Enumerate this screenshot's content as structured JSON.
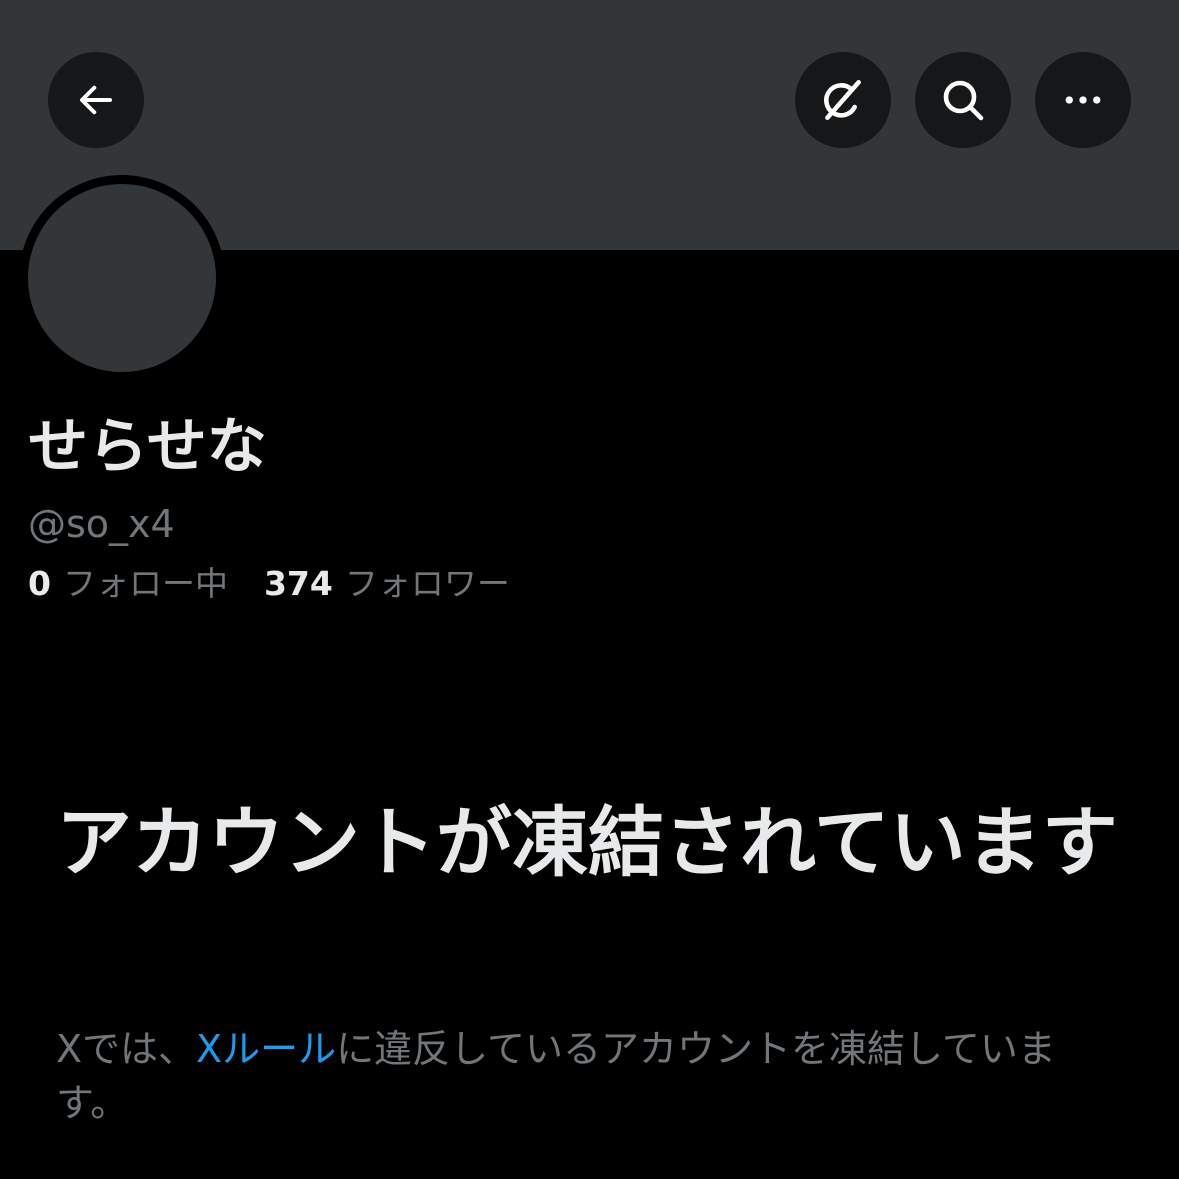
{
  "header": {
    "back_icon": "arrow-left-icon",
    "grok_icon": "grok-icon",
    "search_icon": "search-icon",
    "more_icon": "more-horizontal-icon"
  },
  "profile": {
    "display_name": "せらせな",
    "handle": "@so_x4",
    "following_count": "0",
    "following_label": "フォロー中",
    "followers_count": "374",
    "followers_label": "フォロワー"
  },
  "suspension": {
    "title": "アカウントが凍結されています",
    "desc_prefix": "Xでは、",
    "rules_link": "Xルール",
    "desc_suffix": "に違反しているアカウントを凍結しています。"
  },
  "colors": {
    "background": "#000000",
    "banner": "#333639",
    "link": "#1d9bf0",
    "secondary_text": "#71767b",
    "primary_text": "#e7e9ea"
  }
}
